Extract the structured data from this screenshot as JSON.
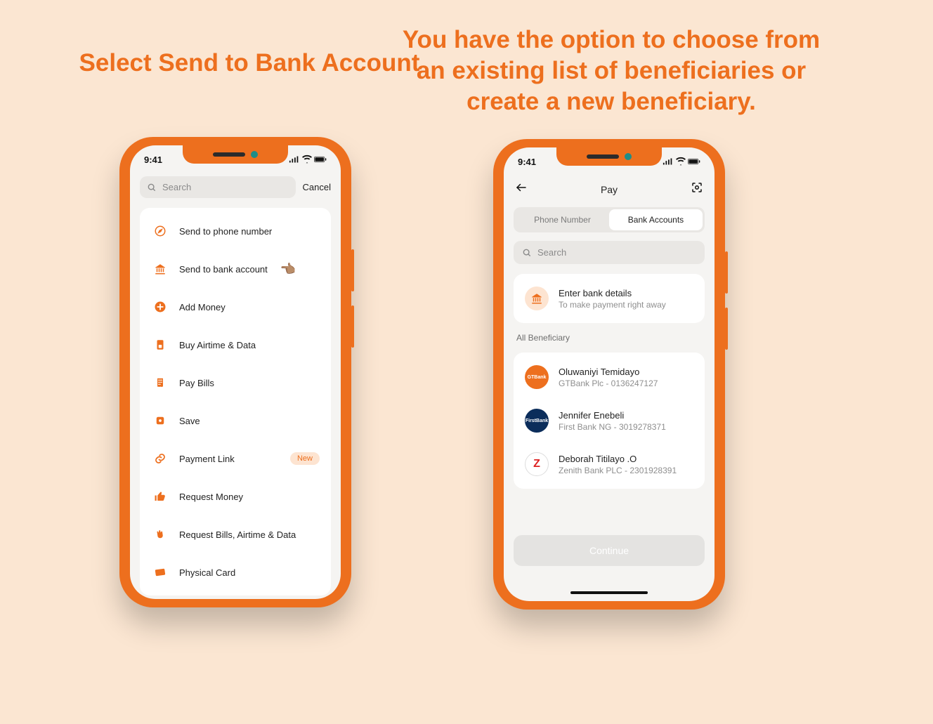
{
  "colors": {
    "accent": "#ed6f1e",
    "bg": "#fbe6d2"
  },
  "headline_left": "Select Send to Bank Account",
  "headline_right": "You have the option to choose from an existing list of beneficiaries or create a new beneficiary.",
  "status_time": "9:41",
  "screen1": {
    "search_placeholder": "Search",
    "cancel": "Cancel",
    "menu": [
      {
        "icon": "compass-icon",
        "label": "Send to phone number"
      },
      {
        "icon": "bank-icon",
        "label": "Send to bank account",
        "pointer": true
      },
      {
        "icon": "plus-icon",
        "label": "Add Money"
      },
      {
        "icon": "sim-icon",
        "label": "Buy Airtime & Data"
      },
      {
        "icon": "receipt-icon",
        "label": "Pay Bills"
      },
      {
        "icon": "piggy-icon",
        "label": "Save"
      },
      {
        "icon": "link-icon",
        "label": "Payment Link",
        "badge": "New"
      },
      {
        "icon": "thumb-icon",
        "label": "Request Money"
      },
      {
        "icon": "wave-icon",
        "label": "Request Bills, Airtime & Data"
      },
      {
        "icon": "card-icon",
        "label": "Physical Card"
      }
    ]
  },
  "screen2": {
    "title": "Pay",
    "tabs": {
      "phone": "Phone Number",
      "bank": "Bank Accounts"
    },
    "search_placeholder": "Search",
    "enter": {
      "title": "Enter bank details",
      "sub": "To make payment right away"
    },
    "section": "All Beneficiary",
    "beneficiaries": [
      {
        "name": "Oluwaniyi Temidayo",
        "sub": "GTBank Plc - 0136247127",
        "avatar_bg": "#ed6f1e",
        "avatar_text": "GTBank"
      },
      {
        "name": "Jennifer Enebeli",
        "sub": "First Bank NG - 3019278371",
        "avatar_bg": "#0b2d5b",
        "avatar_text": "FirstBank"
      },
      {
        "name": "Deborah Titilayo .O",
        "sub": "Zenith Bank PLC - 2301928391",
        "avatar_bg": "#ffffff",
        "avatar_text": "Z",
        "avatar_color": "#d22"
      }
    ],
    "continue": "Continue"
  }
}
